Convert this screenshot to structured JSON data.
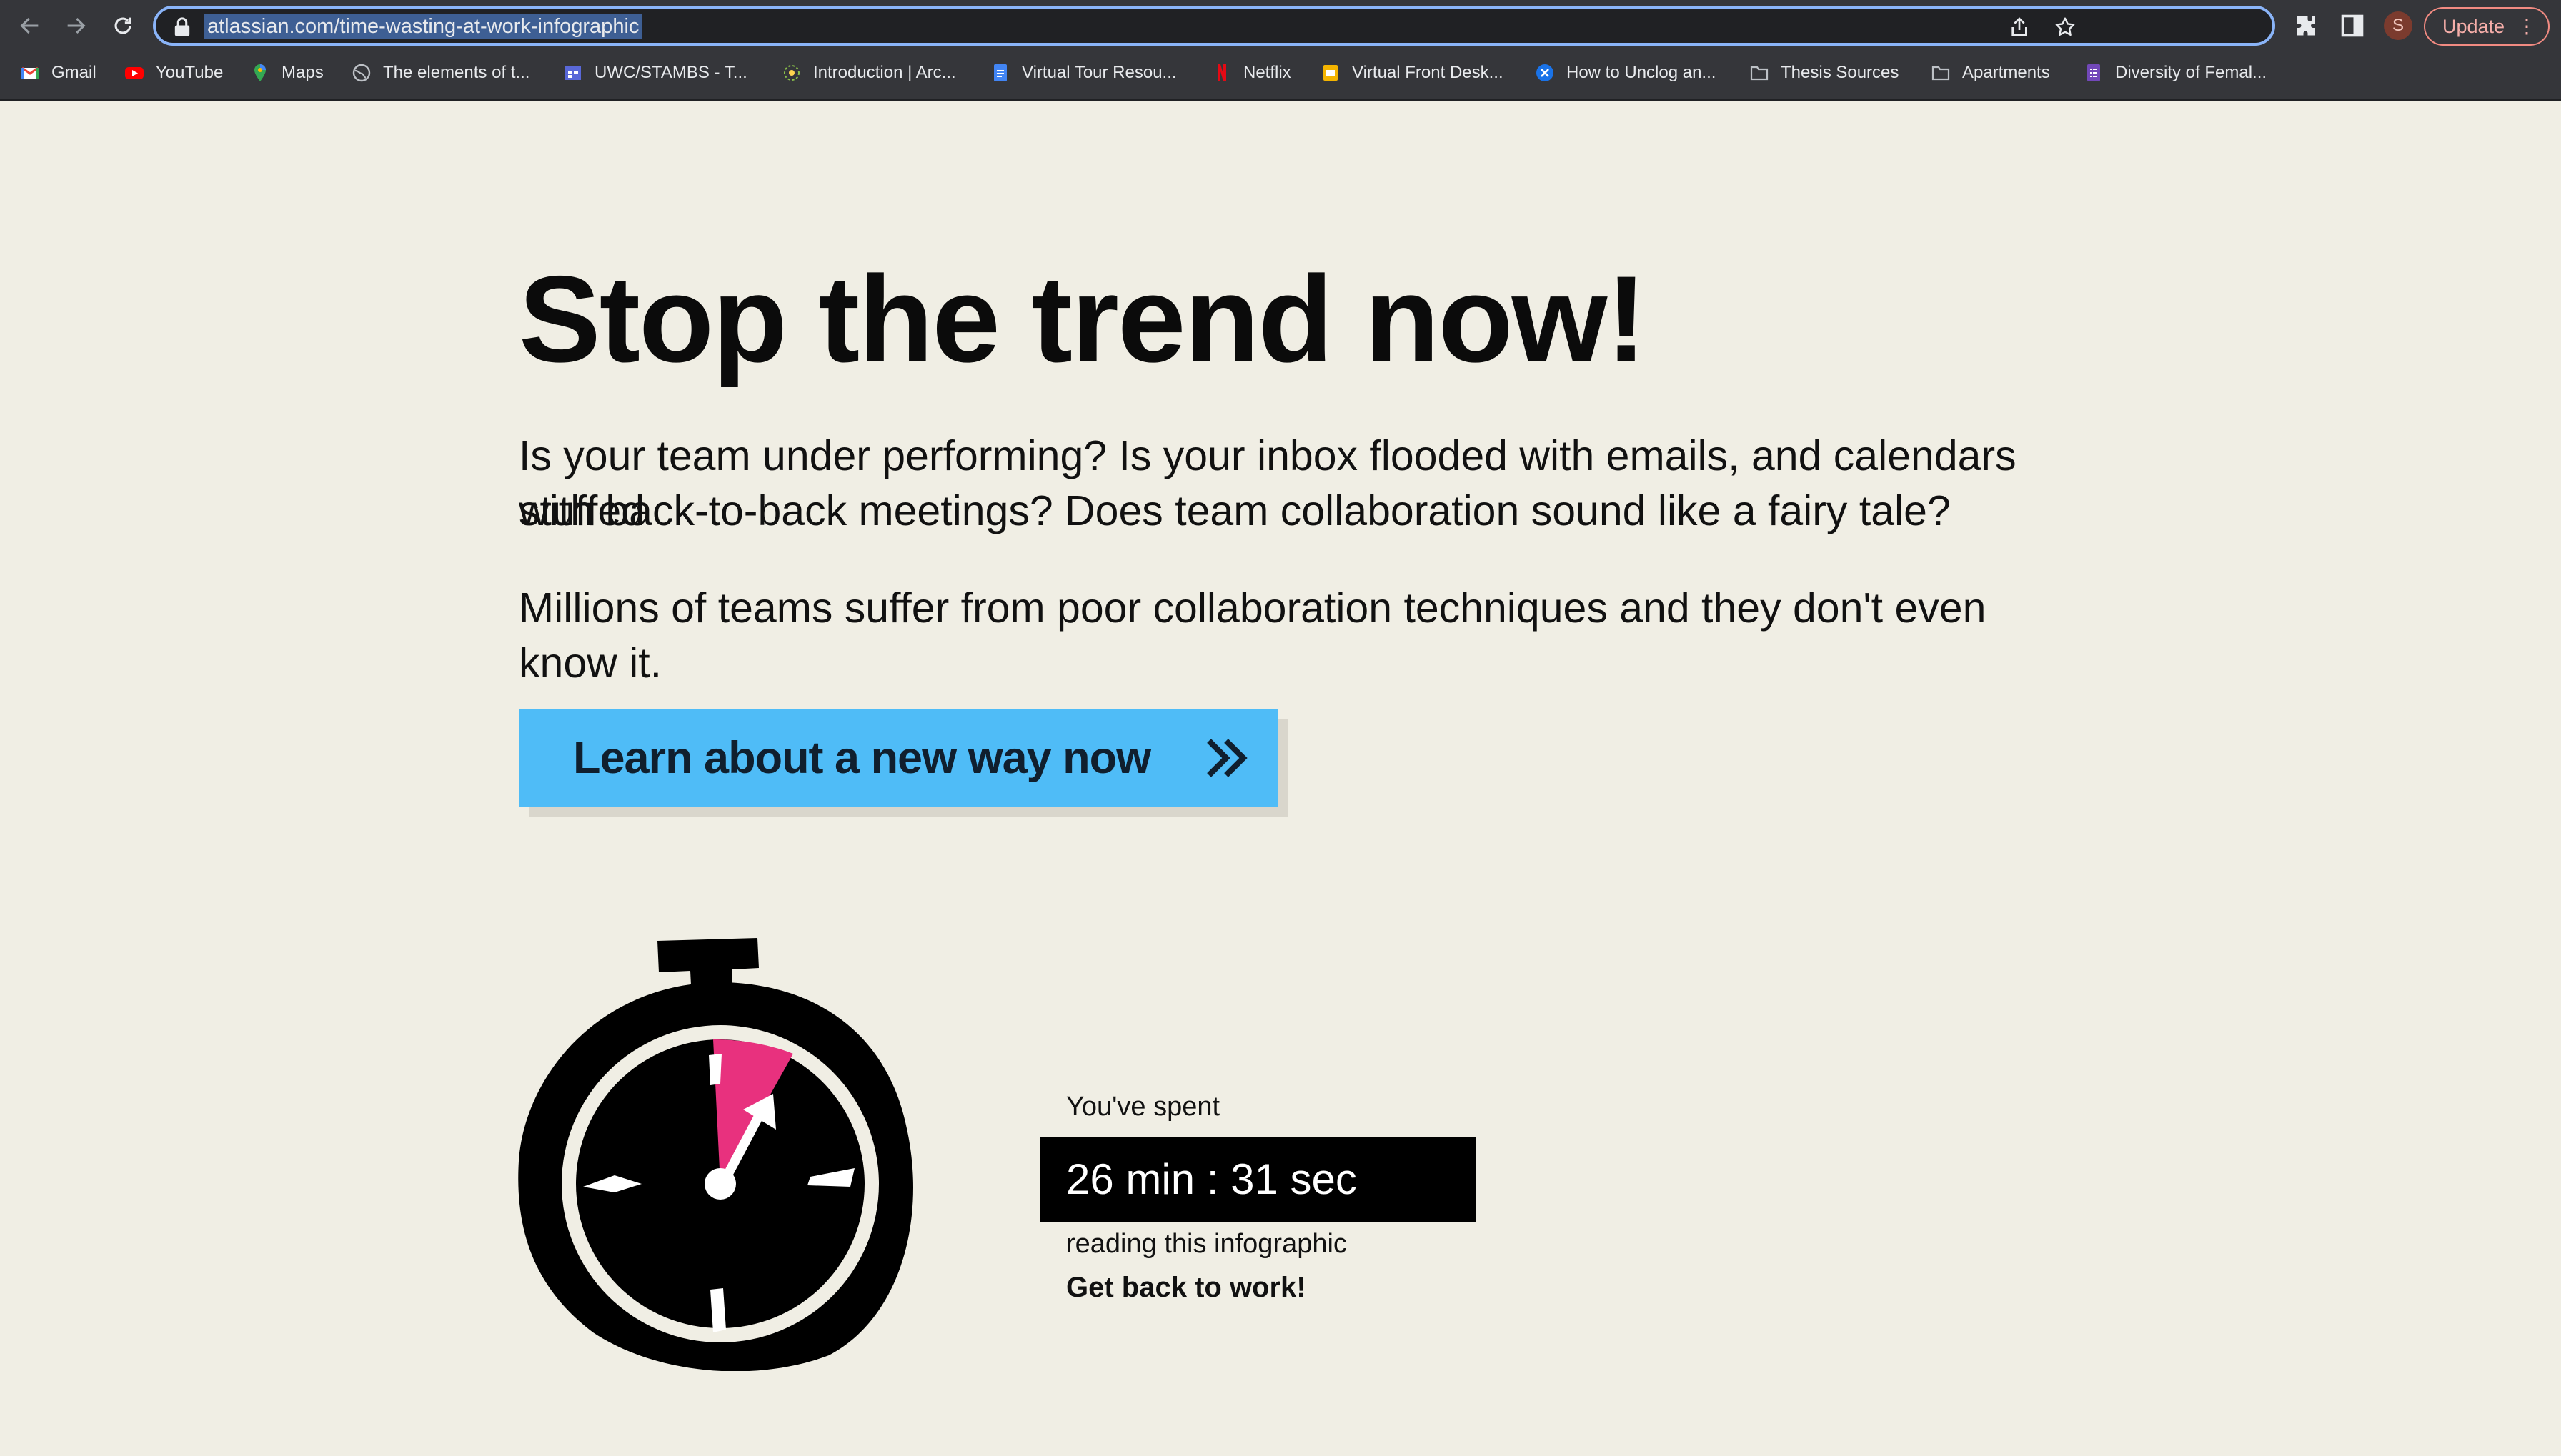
{
  "browser": {
    "url": "atlassian.com/time-wasting-at-work-infographic",
    "profile_initial": "S",
    "update_label": "Update",
    "bookmarks": [
      {
        "label": "Gmail",
        "icon": "gmail-icon"
      },
      {
        "label": "YouTube",
        "icon": "youtube-icon"
      },
      {
        "label": "Maps",
        "icon": "maps-icon"
      },
      {
        "label": "The elements of t...",
        "icon": "globe-icon"
      },
      {
        "label": "UWC/STAMBS - T...",
        "icon": "calendar-icon"
      },
      {
        "label": "Introduction | Arc...",
        "icon": "arcgis-icon"
      },
      {
        "label": "Virtual Tour Resou...",
        "icon": "docs-icon"
      },
      {
        "label": "Netflix",
        "icon": "netflix-icon"
      },
      {
        "label": "Virtual Front Desk...",
        "icon": "slides-icon"
      },
      {
        "label": "How to Unclog an...",
        "icon": "close-circle-icon"
      },
      {
        "label": "Thesis Sources",
        "icon": "folder-icon"
      },
      {
        "label": "Apartments",
        "icon": "folder-icon"
      },
      {
        "label": "Diversity of Femal...",
        "icon": "forms-icon"
      }
    ]
  },
  "page": {
    "headline": "Stop the trend now!",
    "paragraph1_line1": "Is your team under performing? Is your inbox flooded with emails, and calendars stuffed",
    "paragraph1_line2": "with back-to-back meetings? Does  team collaboration  sound like a fairy tale?",
    "paragraph2": "Millions of teams suffer from poor collaboration techniques and they don't even know it.",
    "cta_label": "Learn about a new way now",
    "spent_label": "You've spent",
    "timer_value": "26 min : 31 sec",
    "reading_label": "reading this infographic",
    "back_label": "Get back to work!"
  },
  "colors": {
    "page_background": "#f0eee4",
    "cta_background": "#4fbcf7",
    "stopwatch_accent": "#e8317e",
    "omnibox_focus": "#8ab4f8"
  }
}
